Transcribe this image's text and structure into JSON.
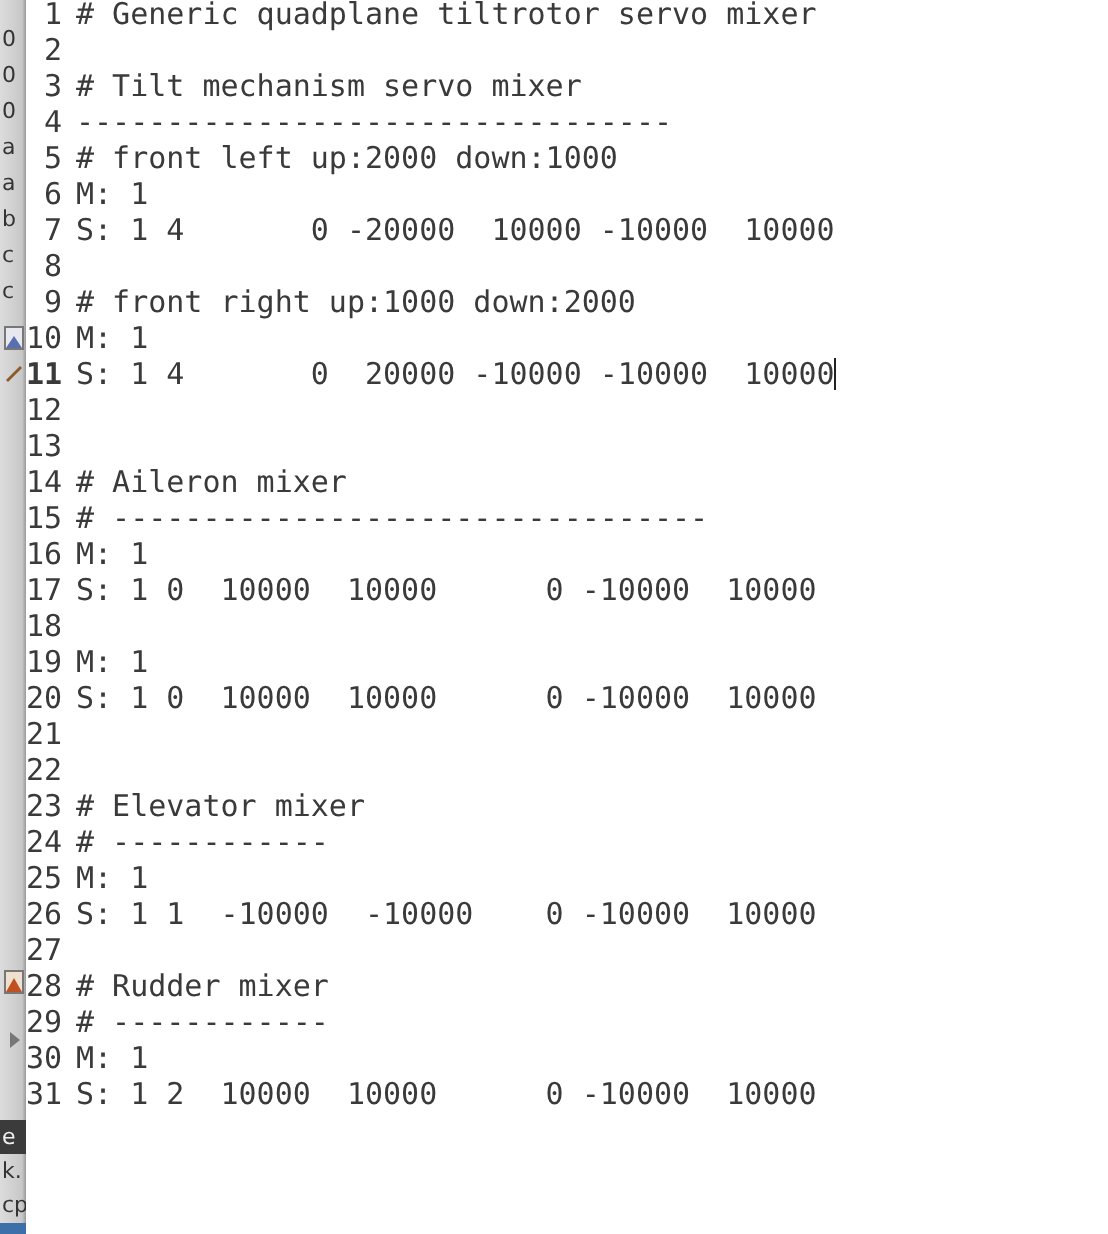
{
  "background_window": {
    "top_fragments": [
      "0",
      "0",
      "0",
      "a",
      "a",
      "b",
      "c",
      "c"
    ],
    "bottom_fragments": [
      "e",
      "k.",
      "cp"
    ]
  },
  "editor": {
    "lines": [
      {
        "number": "1",
        "text": "# Generic quadplane tiltrotor servo mixer",
        "current": false
      },
      {
        "number": "2",
        "current": false
      },
      {
        "number": "3",
        "text": "# Tilt mechanism servo mixer",
        "current": false
      },
      {
        "number": "4",
        "text": "---------------------------------",
        "current": false
      },
      {
        "number": "5",
        "text": "# front left up:2000 down:1000",
        "current": false
      },
      {
        "number": "6",
        "text": "M: 1",
        "current": false
      },
      {
        "number": "7",
        "text": "S: 1 4       0 -20000  10000 -10000  10000",
        "current": false
      },
      {
        "number": "8",
        "current": false
      },
      {
        "number": "9",
        "text": "# front right up:1000 down:2000",
        "current": false
      },
      {
        "number": "10",
        "text": "M: 1",
        "current": false
      },
      {
        "number": "11",
        "text": "S: 1 4       0  20000 -10000 -10000  10000",
        "current": true
      },
      {
        "number": "12",
        "current": false
      },
      {
        "number": "13",
        "current": false
      },
      {
        "number": "14",
        "text": "# Aileron mixer",
        "current": false
      },
      {
        "number": "15",
        "text": "# ---------------------------------",
        "current": false
      },
      {
        "number": "16",
        "text": "M: 1",
        "current": false
      },
      {
        "number": "17",
        "text": "S: 1 0  10000  10000      0 -10000  10000",
        "current": false
      },
      {
        "number": "18",
        "current": false
      },
      {
        "number": "19",
        "text": "M: 1",
        "current": false
      },
      {
        "number": "20",
        "text": "S: 1 0  10000  10000      0 -10000  10000",
        "current": false
      },
      {
        "number": "21",
        "current": false
      },
      {
        "number": "22",
        "current": false
      },
      {
        "number": "23",
        "text": "# Elevator mixer",
        "current": false
      },
      {
        "number": "24",
        "text": "# ------------",
        "current": false
      },
      {
        "number": "25",
        "text": "M: 1",
        "current": false
      },
      {
        "number": "26",
        "text": "S: 1 1  -10000  -10000    0 -10000  10000",
        "current": false
      },
      {
        "number": "27",
        "current": false
      },
      {
        "number": "28",
        "text": "# Rudder mixer",
        "current": false
      },
      {
        "number": "29",
        "text": "# ------------",
        "current": false
      },
      {
        "number": "30",
        "text": "M: 1",
        "current": false
      },
      {
        "number": "31",
        "text": "S: 1 2  10000  10000      0 -10000  10000",
        "current": false
      }
    ]
  }
}
